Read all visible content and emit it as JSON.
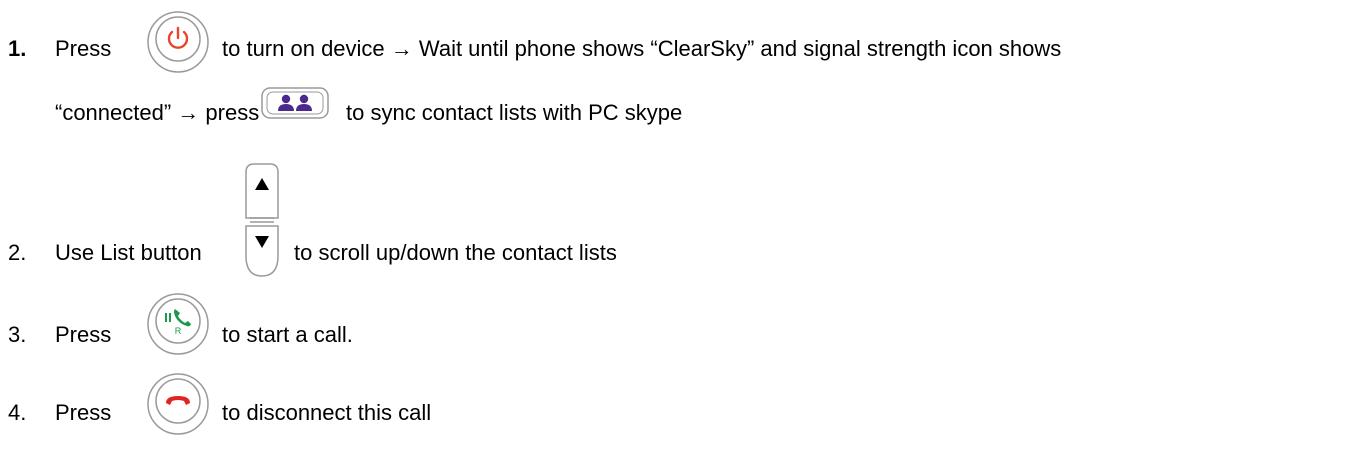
{
  "steps": [
    {
      "number": "1.",
      "parts": {
        "press": "Press",
        "after_power": "to turn on device → Wait until phone shows “ClearSky” and signal strength icon shows",
        "connected": "“connected” → press",
        "after_contacts": "to sync contact lists with PC skype"
      },
      "icons": [
        "power-button-icon",
        "contacts-sync-button-icon"
      ]
    },
    {
      "number": "2.",
      "parts": {
        "use": "Use List button",
        "after_list": "to scroll up/down the contact lists"
      },
      "icons": [
        "list-up-down-button-icon"
      ]
    },
    {
      "number": "3.",
      "parts": {
        "press": "Press",
        "after_call": "to start a call."
      },
      "icons": [
        "call-button-icon"
      ],
      "call_button_letter": "R"
    },
    {
      "number": "4.",
      "parts": {
        "press": "Press",
        "after_end": "to disconnect this call"
      },
      "icons": [
        "end-call-button-icon"
      ]
    }
  ],
  "colors": {
    "power": "#e8452c",
    "contacts": "#4b2a8c",
    "call": "#1a9a4a",
    "end_call": "#e02424",
    "outline": "#9a9a9a"
  }
}
